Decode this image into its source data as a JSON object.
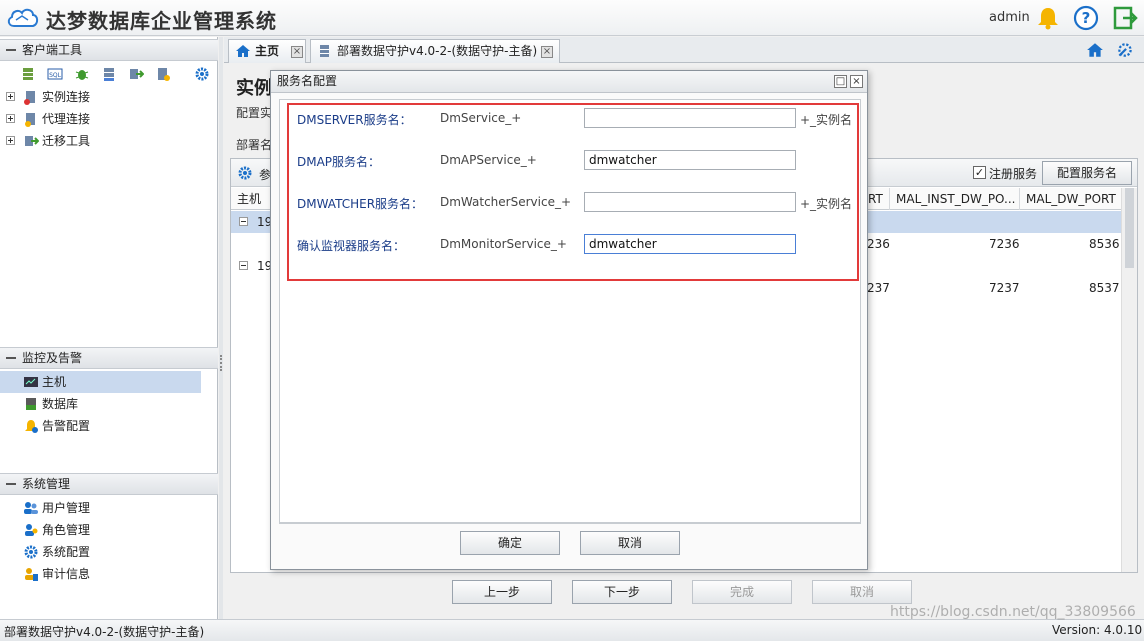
{
  "app": {
    "title": "达梦数据库企业管理系统",
    "user": "admin",
    "version": "Version: 4.0.10",
    "status_text": "部署数据守护v4.0-2-(数据守护-主备)"
  },
  "sidebar": {
    "client_tools": {
      "title": "客户端工具",
      "toolbar_icons": [
        "db-icon",
        "sql-icon",
        "bug-icon",
        "server-icon",
        "migrate-icon",
        "db-tool-icon",
        "gear-icon"
      ],
      "items": [
        {
          "label": "实例连接",
          "icon": "instance-icon"
        },
        {
          "label": "代理连接",
          "icon": "agent-icon"
        },
        {
          "label": "迁移工具",
          "icon": "migrate-icon"
        }
      ]
    },
    "monitor": {
      "title": "监控及告警",
      "items": [
        {
          "label": "主机",
          "icon": "host-icon",
          "selected": true
        },
        {
          "label": "数据库",
          "icon": "database-icon"
        },
        {
          "label": "告警配置",
          "icon": "alarm-icon"
        }
      ]
    },
    "system": {
      "title": "系统管理",
      "items": [
        {
          "label": "用户管理",
          "icon": "users-icon"
        },
        {
          "label": "角色管理",
          "icon": "role-icon"
        },
        {
          "label": "系统配置",
          "icon": "gear-icon"
        },
        {
          "label": "审计信息",
          "icon": "audit-icon"
        }
      ]
    }
  },
  "tabs": [
    {
      "label": "主页",
      "icon": "home-icon"
    },
    {
      "label": "部署数据守护v4.0-2-(数据守护-主备)",
      "icon": "deploy-icon"
    }
  ],
  "main": {
    "heading": "实例",
    "subheading": "配置实",
    "deploy_label": "部署名",
    "grid_toolbar_label": "参",
    "register_service_label": "注册服务",
    "register_service_checked": true,
    "config_service_button": "配置服务名",
    "column_host": "主机",
    "column_rt": "RT",
    "column_inst_dw_port": "MAL_INST_DW_PO...",
    "column_dw_port": "MAL_DW_PORT",
    "rows": [
      {
        "host": "19",
        "rt": "236",
        "inst_dw_port": "7236",
        "dw_port": "8536"
      },
      {
        "host": "19",
        "rt": "237",
        "inst_dw_port": "7237",
        "dw_port": "8537"
      }
    ],
    "buttons": {
      "prev": "上一步",
      "next": "下一步",
      "finish": "完成",
      "cancel": "取消"
    }
  },
  "dialog": {
    "title": "服务名配置",
    "fields": [
      {
        "label": "DMSERVER服务名：",
        "prefix": "DmService_+",
        "value": "",
        "suffix": "+_实例名"
      },
      {
        "label": "DMAP服务名：",
        "prefix": "DmAPService_+",
        "value": "dmwatcher",
        "suffix": ""
      },
      {
        "label": "DMWATCHER服务名：",
        "prefix": "DmWatcherService_+",
        "value": "",
        "suffix": "+_实例名"
      },
      {
        "label": "确认监视器服务名：",
        "prefix": "DmMonitorService_+",
        "value": "dmwatcher",
        "suffix": ""
      }
    ],
    "ok": "确定",
    "cancel": "取消"
  },
  "watermark": "https://blog.csdn.net/qq_33809566",
  "colors": {
    "accent": "#1a6fc9",
    "highlight_border": "#e23a3a",
    "selection": "#c9d9ee"
  }
}
